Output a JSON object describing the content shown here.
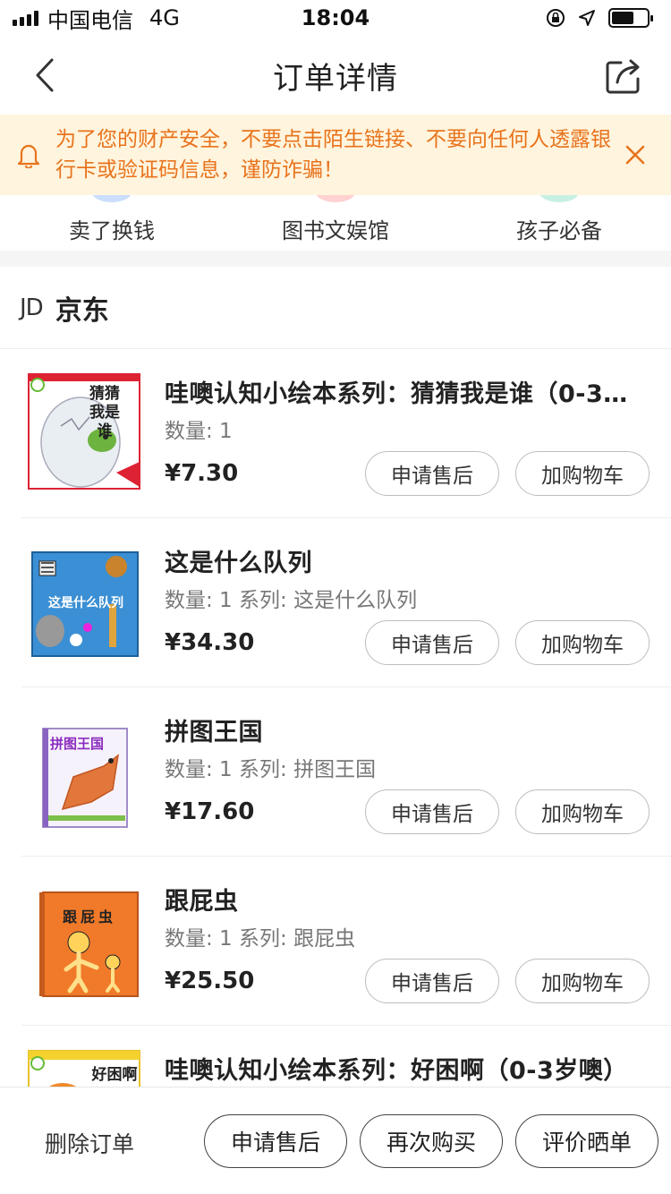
{
  "status_bar": {
    "carrier": "中国电信",
    "network": "4G",
    "time": "18:04"
  },
  "nav": {
    "title": "订单详情"
  },
  "notice": {
    "text": "为了您的财产安全，不要点击陌生链接、不要向任何人透露银行卡或验证码信息，谨防诈骗！"
  },
  "categories": [
    {
      "label": "卖了换钱",
      "color": "#6aa0ff"
    },
    {
      "label": "图书文娱馆",
      "color": "#ff7a7a"
    },
    {
      "label": "孩子必备",
      "color": "#5fd3b0"
    }
  ],
  "store": {
    "logo": "JD",
    "name": "京东"
  },
  "products": [
    {
      "title": "哇噢认知小绘本系列：猜猜我是谁（0-3…",
      "meta": "数量: 1",
      "price": "¥7.30",
      "cover_text": "猜猜我是谁",
      "aftersale_label": "申请售后",
      "cart_label": "加购物车"
    },
    {
      "title": "这是什么队列",
      "meta": "数量: 1 系列: 这是什么队列",
      "price": "¥34.30",
      "cover_text": "这是什么队列",
      "aftersale_label": "申请售后",
      "cart_label": "加购物车"
    },
    {
      "title": "拼图王国",
      "meta": "数量: 1 系列: 拼图王国",
      "price": "¥17.60",
      "cover_text": "拼图王国",
      "aftersale_label": "申请售后",
      "cart_label": "加购物车"
    },
    {
      "title": "跟屁虫",
      "meta": "数量: 1 系列: 跟屁虫",
      "price": "¥25.50",
      "cover_text": "跟屁虫",
      "aftersale_label": "申请售后",
      "cart_label": "加购物车"
    },
    {
      "title": "哇噢认知小绘本系列：好困啊（0-3岁噢）",
      "meta": "",
      "price": "",
      "cover_text": "好困啊",
      "aftersale_label": "",
      "cart_label": ""
    }
  ],
  "bottom_bar": {
    "delete_label": "删除订单",
    "aftersale_label": "申请售后",
    "rebuy_label": "再次购买",
    "review_label": "评价晒单"
  },
  "colors": {
    "notice_text": "#e8731c",
    "notice_bg": "#fff4dd"
  }
}
